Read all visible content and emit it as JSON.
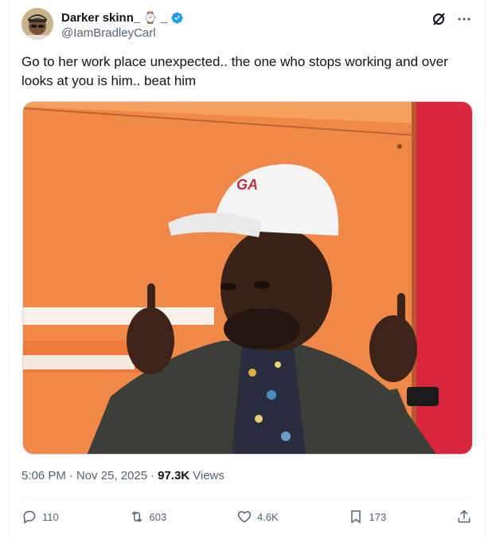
{
  "author": {
    "display_name": "Darker skinn_",
    "emoji": "⌚",
    "suffix": "_",
    "handle": "@IamBradleyCarl",
    "verified": true
  },
  "tweet": {
    "text": "Go to her work place unexpected.. the one who stops working and over looks at you is him.. beat him",
    "time": "5:06 PM",
    "separator": "·",
    "date": "Nov 25, 2025",
    "views_count": "97.3K",
    "views_label": "Views"
  },
  "media": {
    "cap_logo_text": "GA"
  },
  "actions": {
    "replies": "110",
    "reposts": "603",
    "likes": "4.6K",
    "bookmarks": "173"
  },
  "colors": {
    "accent": "#1d9bf0",
    "text_secondary": "#536471",
    "wall_orange": "#f0874a",
    "wall_red": "#d8263a"
  },
  "icons": [
    "grok-icon",
    "more-icon",
    "verified-badge-icon",
    "reply-icon",
    "repost-icon",
    "like-icon",
    "bookmark-icon",
    "share-icon"
  ]
}
